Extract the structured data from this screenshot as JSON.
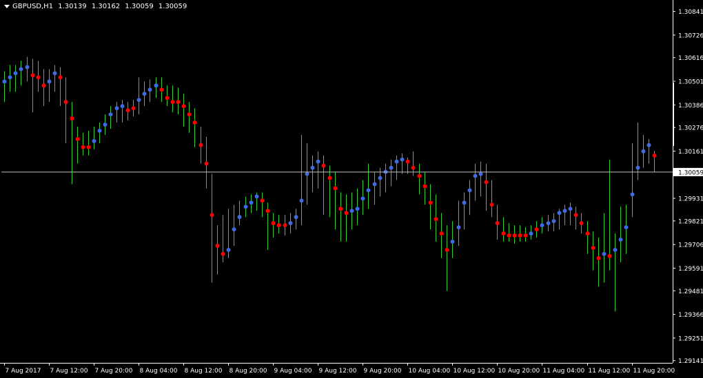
{
  "header": {
    "symbol": "GBPUSD,H1",
    "open": "1.30139",
    "high": "1.30162",
    "low": "1.30059",
    "close": "1.30059"
  },
  "colors": {
    "background": "#000000",
    "candle": "#32cd32",
    "axis": "#ffffff",
    "dot_up": "#4169e1",
    "dot_down": "#ff0000",
    "bid_line": "#c0c0c0",
    "current_label_bg": "#ffffff"
  },
  "chart_data": {
    "type": "line",
    "y_ticks": [
      "1.30841",
      "1.30726",
      "1.30616",
      "1.30501",
      "1.30386",
      "1.30276",
      "1.30161",
      "1.30059",
      "1.29931",
      "1.29821",
      "1.29706",
      "1.29591",
      "1.29481",
      "1.29366",
      "1.29251",
      "1.29141"
    ],
    "x_ticks": [
      "7 Aug 2017",
      "7 Aug 12:00",
      "7 Aug 20:00",
      "8 Aug 04:00",
      "8 Aug 12:00",
      "8 Aug 20:00",
      "9 Aug 04:00",
      "9 Aug 12:00",
      "9 Aug 20:00",
      "10 Aug 04:00",
      "10 Aug 12:00",
      "10 Aug 20:00",
      "11 Aug 04:00",
      "11 Aug 12:00",
      "11 Aug 20:00"
    ],
    "current_price": "1.30059",
    "ylim": [
      1.2913,
      1.3089
    ],
    "bars": [
      {
        "h": 1.3055,
        "l": 1.304,
        "c": 1.305,
        "d": "up"
      },
      {
        "h": 1.3058,
        "l": 1.3045,
        "c": 1.3052,
        "d": "up"
      },
      {
        "h": 1.3058,
        "l": 1.3045,
        "c": 1.3054,
        "d": "up"
      },
      {
        "h": 1.306,
        "l": 1.3048,
        "c": 1.3056,
        "d": "up"
      },
      {
        "h": 1.3062,
        "l": 1.305,
        "c": 1.3057,
        "d": "up"
      },
      {
        "h": 1.3061,
        "l": 1.3035,
        "c": 1.3053,
        "d": "down"
      },
      {
        "h": 1.306,
        "l": 1.3045,
        "c": 1.3052,
        "d": "down"
      },
      {
        "h": 1.3056,
        "l": 1.3038,
        "c": 1.3048,
        "d": "down"
      },
      {
        "h": 1.3056,
        "l": 1.304,
        "c": 1.305,
        "d": "up"
      },
      {
        "h": 1.3058,
        "l": 1.3045,
        "c": 1.3054,
        "d": "up"
      },
      {
        "h": 1.3057,
        "l": 1.3038,
        "c": 1.3052,
        "d": "down"
      },
      {
        "h": 1.3052,
        "l": 1.302,
        "c": 1.304,
        "d": "down"
      },
      {
        "h": 1.304,
        "l": 1.3,
        "c": 1.3032,
        "d": "down"
      },
      {
        "h": 1.3028,
        "l": 1.301,
        "c": 1.3022,
        "d": "down"
      },
      {
        "h": 1.3025,
        "l": 1.3014,
        "c": 1.3018,
        "d": "down"
      },
      {
        "h": 1.3026,
        "l": 1.3014,
        "c": 1.3018,
        "d": "down"
      },
      {
        "h": 1.3028,
        "l": 1.3017,
        "c": 1.3021,
        "d": "up"
      },
      {
        "h": 1.303,
        "l": 1.302,
        "c": 1.3026,
        "d": "up"
      },
      {
        "h": 1.3034,
        "l": 1.3024,
        "c": 1.3029,
        "d": "up"
      },
      {
        "h": 1.3038,
        "l": 1.3027,
        "c": 1.3034,
        "d": "up"
      },
      {
        "h": 1.304,
        "l": 1.303,
        "c": 1.3037,
        "d": "up"
      },
      {
        "h": 1.3041,
        "l": 1.303,
        "c": 1.3038,
        "d": "up"
      },
      {
        "h": 1.304,
        "l": 1.3031,
        "c": 1.3036,
        "d": "down"
      },
      {
        "h": 1.3041,
        "l": 1.3033,
        "c": 1.3037,
        "d": "down"
      },
      {
        "h": 1.3052,
        "l": 1.3034,
        "c": 1.3041,
        "d": "up"
      },
      {
        "h": 1.305,
        "l": 1.3038,
        "c": 1.3044,
        "d": "up"
      },
      {
        "h": 1.3051,
        "l": 1.304,
        "c": 1.3046,
        "d": "up"
      },
      {
        "h": 1.3052,
        "l": 1.3042,
        "c": 1.3048,
        "d": "up"
      },
      {
        "h": 1.3052,
        "l": 1.304,
        "c": 1.3046,
        "d": "down"
      },
      {
        "h": 1.3048,
        "l": 1.3038,
        "c": 1.3042,
        "d": "down"
      },
      {
        "h": 1.3048,
        "l": 1.3035,
        "c": 1.304,
        "d": "down"
      },
      {
        "h": 1.3047,
        "l": 1.3034,
        "c": 1.304,
        "d": "down"
      },
      {
        "h": 1.3044,
        "l": 1.3028,
        "c": 1.3038,
        "d": "down"
      },
      {
        "h": 1.304,
        "l": 1.3025,
        "c": 1.3034,
        "d": "down"
      },
      {
        "h": 1.3037,
        "l": 1.3018,
        "c": 1.303,
        "d": "down"
      },
      {
        "h": 1.3028,
        "l": 1.301,
        "c": 1.3019,
        "d": "down"
      },
      {
        "h": 1.3023,
        "l": 1.2998,
        "c": 1.301,
        "d": "down"
      },
      {
        "h": 1.3005,
        "l": 1.2952,
        "c": 1.2985,
        "d": "down"
      },
      {
        "h": 1.298,
        "l": 1.2956,
        "c": 1.297,
        "d": "down"
      },
      {
        "h": 1.2985,
        "l": 1.2962,
        "c": 1.2966,
        "d": "down"
      },
      {
        "h": 1.2988,
        "l": 1.2964,
        "c": 1.2968,
        "d": "up"
      },
      {
        "h": 1.299,
        "l": 1.297,
        "c": 1.2978,
        "d": "up"
      },
      {
        "h": 1.2992,
        "l": 1.298,
        "c": 1.2984,
        "d": "up"
      },
      {
        "h": 1.2994,
        "l": 1.2984,
        "c": 1.2989,
        "d": "up"
      },
      {
        "h": 1.2995,
        "l": 1.2986,
        "c": 1.2991,
        "d": "up"
      },
      {
        "h": 1.2996,
        "l": 1.2987,
        "c": 1.2994,
        "d": "up"
      },
      {
        "h": 1.2996,
        "l": 1.2984,
        "c": 1.2992,
        "d": "down"
      },
      {
        "h": 1.2991,
        "l": 1.2968,
        "c": 1.2987,
        "d": "down"
      },
      {
        "h": 1.2986,
        "l": 1.2974,
        "c": 1.2981,
        "d": "down"
      },
      {
        "h": 1.2985,
        "l": 1.2976,
        "c": 1.298,
        "d": "down"
      },
      {
        "h": 1.2985,
        "l": 1.2975,
        "c": 1.298,
        "d": "down"
      },
      {
        "h": 1.2986,
        "l": 1.2976,
        "c": 1.2981,
        "d": "up"
      },
      {
        "h": 1.2988,
        "l": 1.2978,
        "c": 1.2984,
        "d": "up"
      },
      {
        "h": 1.3024,
        "l": 1.298,
        "c": 1.2992,
        "d": "up"
      },
      {
        "h": 1.302,
        "l": 1.299,
        "c": 1.3005,
        "d": "up"
      },
      {
        "h": 1.3014,
        "l": 1.2996,
        "c": 1.3008,
        "d": "up"
      },
      {
        "h": 1.3016,
        "l": 1.2998,
        "c": 1.3011,
        "d": "up"
      },
      {
        "h": 1.3014,
        "l": 1.2985,
        "c": 1.3009,
        "d": "down"
      },
      {
        "h": 1.3009,
        "l": 1.2984,
        "c": 1.3003,
        "d": "down"
      },
      {
        "h": 1.3006,
        "l": 1.2978,
        "c": 1.2998,
        "d": "down"
      },
      {
        "h": 1.2996,
        "l": 1.2972,
        "c": 1.2988,
        "d": "down"
      },
      {
        "h": 1.2995,
        "l": 1.2972,
        "c": 1.2986,
        "d": "down"
      },
      {
        "h": 1.2996,
        "l": 1.2978,
        "c": 1.2987,
        "d": "up"
      },
      {
        "h": 1.2998,
        "l": 1.298,
        "c": 1.2988,
        "d": "up"
      },
      {
        "h": 1.3002,
        "l": 1.2985,
        "c": 1.2993,
        "d": "up"
      },
      {
        "h": 1.301,
        "l": 1.2988,
        "c": 1.2997,
        "d": "up"
      },
      {
        "h": 1.3006,
        "l": 1.299,
        "c": 1.3,
        "d": "up"
      },
      {
        "h": 1.3008,
        "l": 1.2994,
        "c": 1.3003,
        "d": "up"
      },
      {
        "h": 1.301,
        "l": 1.2996,
        "c": 1.3006,
        "d": "up"
      },
      {
        "h": 1.3012,
        "l": 1.2999,
        "c": 1.3008,
        "d": "up"
      },
      {
        "h": 1.3014,
        "l": 1.3002,
        "c": 1.3011,
        "d": "up"
      },
      {
        "h": 1.3015,
        "l": 1.3005,
        "c": 1.3012,
        "d": "up"
      },
      {
        "h": 1.3013,
        "l": 1.3005,
        "c": 1.3011,
        "d": "down"
      },
      {
        "h": 1.3016,
        "l": 1.3004,
        "c": 1.3008,
        "d": "down"
      },
      {
        "h": 1.301,
        "l": 1.2995,
        "c": 1.3004,
        "d": "down"
      },
      {
        "h": 1.3006,
        "l": 1.299,
        "c": 1.2999,
        "d": "down"
      },
      {
        "h": 1.3,
        "l": 1.2978,
        "c": 1.2991,
        "d": "down"
      },
      {
        "h": 1.2995,
        "l": 1.2972,
        "c": 1.2983,
        "d": "down"
      },
      {
        "h": 1.2986,
        "l": 1.2964,
        "c": 1.2976,
        "d": "down"
      },
      {
        "h": 1.298,
        "l": 1.2948,
        "c": 1.2968,
        "d": "down"
      },
      {
        "h": 1.2982,
        "l": 1.2964,
        "c": 1.2972,
        "d": "up"
      },
      {
        "h": 1.2992,
        "l": 1.297,
        "c": 1.2979,
        "d": "up"
      },
      {
        "h": 1.2996,
        "l": 1.2978,
        "c": 1.2991,
        "d": "up"
      },
      {
        "h": 1.3002,
        "l": 1.2985,
        "c": 1.2997,
        "d": "up"
      },
      {
        "h": 1.301,
        "l": 1.2992,
        "c": 1.3004,
        "d": "up"
      },
      {
        "h": 1.3011,
        "l": 1.2994,
        "c": 1.3005,
        "d": "up"
      },
      {
        "h": 1.301,
        "l": 1.2987,
        "c": 1.3001,
        "d": "down"
      },
      {
        "h": 1.3002,
        "l": 1.2984,
        "c": 1.299,
        "d": "down"
      },
      {
        "h": 1.299,
        "l": 1.2973,
        "c": 1.2981,
        "d": "down"
      },
      {
        "h": 1.2984,
        "l": 1.2972,
        "c": 1.2976,
        "d": "down"
      },
      {
        "h": 1.2981,
        "l": 1.2972,
        "c": 1.2975,
        "d": "down"
      },
      {
        "h": 1.298,
        "l": 1.2971,
        "c": 1.2975,
        "d": "down"
      },
      {
        "h": 1.298,
        "l": 1.2972,
        "c": 1.2975,
        "d": "down"
      },
      {
        "h": 1.2979,
        "l": 1.2972,
        "c": 1.2975,
        "d": "down"
      },
      {
        "h": 1.298,
        "l": 1.2973,
        "c": 1.2976,
        "d": "up"
      },
      {
        "h": 1.2982,
        "l": 1.2974,
        "c": 1.2978,
        "d": "down"
      },
      {
        "h": 1.2984,
        "l": 1.2976,
        "c": 1.298,
        "d": "up"
      },
      {
        "h": 1.2985,
        "l": 1.2977,
        "c": 1.2981,
        "d": "up"
      },
      {
        "h": 1.2986,
        "l": 1.2977,
        "c": 1.2982,
        "d": "up"
      },
      {
        "h": 1.2988,
        "l": 1.2978,
        "c": 1.2986,
        "d": "up"
      },
      {
        "h": 1.299,
        "l": 1.298,
        "c": 1.2987,
        "d": "up"
      },
      {
        "h": 1.2991,
        "l": 1.298,
        "c": 1.2988,
        "d": "up"
      },
      {
        "h": 1.2989,
        "l": 1.2978,
        "c": 1.2985,
        "d": "down"
      },
      {
        "h": 1.2986,
        "l": 1.2976,
        "c": 1.2981,
        "d": "down"
      },
      {
        "h": 1.2982,
        "l": 1.2966,
        "c": 1.2976,
        "d": "down"
      },
      {
        "h": 1.2977,
        "l": 1.2958,
        "c": 1.2969,
        "d": "down"
      },
      {
        "h": 1.2974,
        "l": 1.295,
        "c": 1.2964,
        "d": "down"
      },
      {
        "h": 1.2986,
        "l": 1.2952,
        "c": 1.2966,
        "d": "up"
      },
      {
        "h": 1.3012,
        "l": 1.2958,
        "c": 1.2965,
        "d": "down"
      },
      {
        "h": 1.2976,
        "l": 1.2938,
        "c": 1.2968,
        "d": "up"
      },
      {
        "h": 1.2989,
        "l": 1.2962,
        "c": 1.2973,
        "d": "up"
      },
      {
        "h": 1.299,
        "l": 1.2966,
        "c": 1.2979,
        "d": "up"
      },
      {
        "h": 1.302,
        "l": 1.2984,
        "c": 1.2995,
        "d": "up"
      },
      {
        "h": 1.303,
        "l": 1.3002,
        "c": 1.3008,
        "d": "up"
      },
      {
        "h": 1.3024,
        "l": 1.3008,
        "c": 1.3016,
        "d": "up"
      },
      {
        "h": 1.3022,
        "l": 1.301,
        "c": 1.3019,
        "d": "up"
      },
      {
        "h": 1.30162,
        "l": 1.30059,
        "c": 1.30139,
        "d": "down"
      }
    ]
  }
}
